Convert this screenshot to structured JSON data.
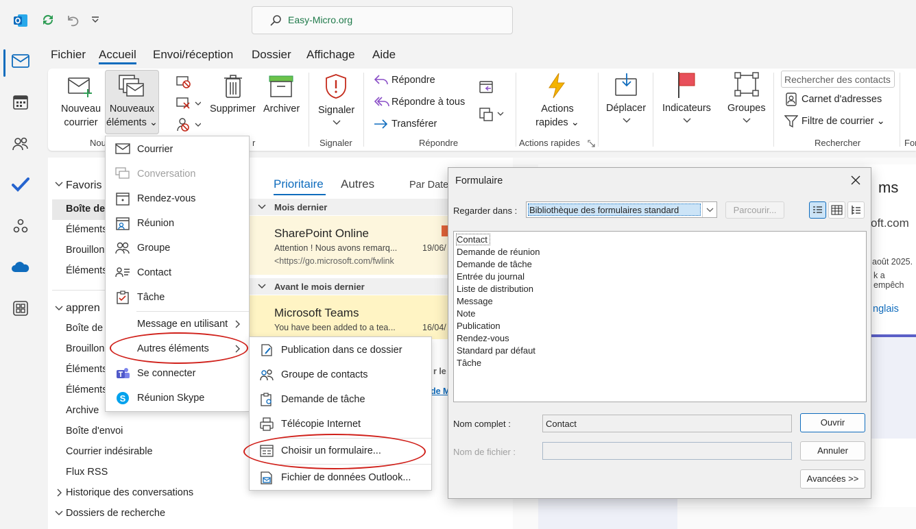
{
  "title_bar": {
    "search_text": "Easy-Micro.org"
  },
  "menu_tabs": [
    "Fichier",
    "Accueil",
    "Envoi/réception",
    "Dossier",
    "Affichage",
    "Aide"
  ],
  "ribbon": {
    "new_mail": "Nouveau courrier",
    "new_mail_l1": "Nouveau",
    "new_mail_l2": "courrier",
    "new_items_l1": "Nouveaux",
    "new_items_l2": "éléments ⌄",
    "group_new_partial": "Nou",
    "group_delete_partial": "r",
    "delete": "Supprimer",
    "archive": "Archiver",
    "report": "Signaler",
    "report_group": "Signaler",
    "reply": "Répondre",
    "reply_all": "Répondre à tous",
    "forward": "Transférer",
    "reply_group": "Répondre",
    "quick_actions_l1": "Actions",
    "quick_actions_l2": "rapides ⌄",
    "quick_actions_group": "Actions rapides",
    "move": "Déplacer",
    "flags": "Indicateurs",
    "groups": "Groupes",
    "search_contacts": "Rechercher des contacts",
    "address_book": "Carnet d'adresses",
    "filter_mail": "Filtre de courrier ⌄",
    "search_group": "Rechercher",
    "partial_right": "For"
  },
  "folders": {
    "favorites": "Favoris",
    "inbox_fav": "Boîte de",
    "sent_fav": "Éléments",
    "drafts_fav": "Brouillon",
    "deleted_fav": "Éléments",
    "account": "appren",
    "items": [
      "Boîte de",
      "Brouillon",
      "Éléments",
      "Éléments",
      "Archive",
      "Boîte d'envoi",
      "Courrier indésirable",
      "Flux RSS"
    ],
    "history": "Historique des conversations",
    "search_folders": "Dossiers de recherche"
  },
  "message_list": {
    "tab_focused": "Prioritaire",
    "tab_other": "Autres",
    "sort": "Par Date",
    "group1": "Mois dernier",
    "msg1": {
      "sender": "SharePoint Online",
      "preview": "Attention ! Nous avons remarq...",
      "date": "19/06/",
      "url": "<https://go.microsoft.com/fwlink"
    },
    "group2": "Avant le mois dernier",
    "msg2": {
      "sender": "Microsoft Teams",
      "preview": "You have been added to a tea...",
      "date": "16/04/"
    },
    "partial1": "r le",
    "partial2": "de M"
  },
  "reading_pane": {
    "title_partial": "ms",
    "domain_partial": "oft.com",
    "date_partial": "août 2025.",
    "text_partial": "k a empêch",
    "link_partial": "nglais"
  },
  "new_items_menu": {
    "items": [
      "Courrier",
      "Conversation",
      "Rendez-vous",
      "Réunion",
      "Groupe",
      "Contact",
      "Tâche",
      "Message en utilisant",
      "Autres éléments",
      "Se connecter",
      "Réunion Skype"
    ]
  },
  "other_items_menu": {
    "items": [
      "Publication dans ce dossier",
      "Groupe de contacts",
      "Demande de tâche",
      "Télécopie Internet",
      "Choisir un formulaire...",
      "Fichier de données Outlook..."
    ]
  },
  "dialog": {
    "title": "Formulaire",
    "look_in_label": "Regarder dans :",
    "look_in_value": "Bibliothèque des formulaires standard",
    "browse": "Parcourir...",
    "forms": [
      "Contact",
      "Demande de réunion",
      "Demande de tâche",
      "Entrée du journal",
      "Liste de distribution",
      "Message",
      "Note",
      "Publication",
      "Rendez-vous",
      "Standard par défaut",
      "Tâche"
    ],
    "full_name_label": "Nom complet :",
    "full_name_value": "Contact",
    "file_name_label": "Nom de fichier :",
    "open": "Ouvrir",
    "cancel": "Annuler",
    "advanced": "Avancées >>"
  },
  "colors": {
    "accent": "#0f6cbd",
    "annotation": "#d0201a",
    "highlight_row": "#fdf6dd",
    "selected_row": "#fff4c4"
  }
}
